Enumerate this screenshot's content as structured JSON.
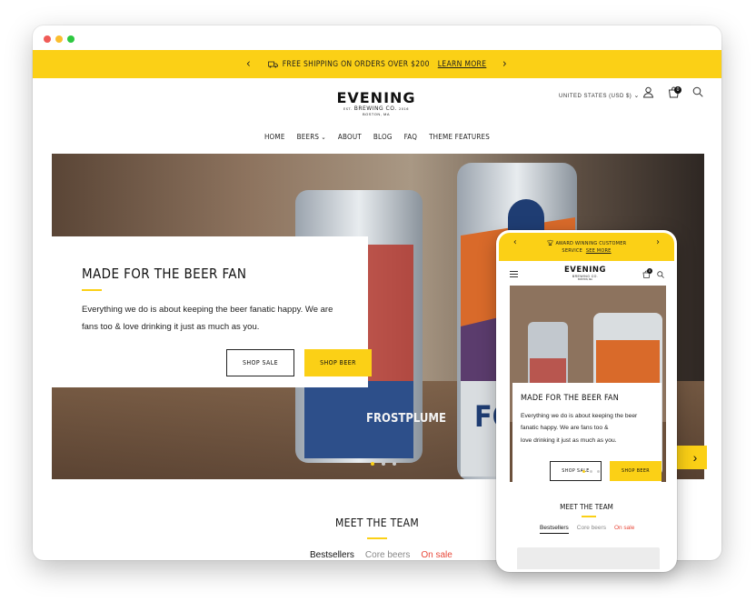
{
  "colors": {
    "accent": "#fbd016",
    "dot_red": "#f05b57",
    "dot_yellow": "#fbbe2e",
    "dot_green": "#2dc840",
    "sale": "#e8483a"
  },
  "promo": {
    "text": "FREE SHIPPING ON ORDERS OVER $200",
    "link": "LEARN MORE",
    "prev_icon": "chevron-left-icon",
    "next_icon": "chevron-right-icon",
    "truck_icon": "truck-icon"
  },
  "logo": {
    "main": "EVENING",
    "sub": "BREWING CO.",
    "small_left": "EST.",
    "small_right": "2016",
    "location": "BOSTON, MA"
  },
  "header": {
    "currency": "UNITED STATES (USD $)",
    "cart_count": "0"
  },
  "nav": [
    {
      "label": "HOME"
    },
    {
      "label": "BEERS"
    },
    {
      "label": "ABOUT"
    },
    {
      "label": "BLOG"
    },
    {
      "label": "FAQ"
    },
    {
      "label": "THEME FEATURES"
    }
  ],
  "hero": {
    "title": "MADE FOR THE BEER FAN",
    "body": "Everything we do is about keeping the beer fanatic happy. We are fans too & love drinking it just as much as you.",
    "btn_sale": "SHOP SALE",
    "btn_beer": "SHOP BEER",
    "can_left_text": "FROSTPLUME",
    "can_right_text": "FO",
    "active_slide": 1,
    "slide_count": 3
  },
  "team": {
    "title": "MEET THE TEAM",
    "tabs": [
      {
        "label": "Bestsellers"
      },
      {
        "label": "Core beers"
      },
      {
        "label": "On sale"
      }
    ]
  },
  "phone": {
    "promo_line1": "AWARD WINNING CUSTOMER",
    "promo_line2": "SERVICE",
    "promo_link": "SEE MORE",
    "logo_main": "EVENING",
    "logo_sub": "BREWING CO.",
    "logo_loc": "BOSTON, MA",
    "cart_count": "0",
    "hero_title": "MADE FOR THE BEER FAN",
    "hero_body_1": "Everything we do is about keeping the beer",
    "hero_body_2": "fanatic happy. We are fans too &",
    "hero_body_3": "love drinking it just as much as you.",
    "btn_sale": "SHOP SALE",
    "btn_beer": "SHOP BEER",
    "can_text": "BREWING CO.",
    "team_title": "MEET THE TEAM",
    "tabs": [
      {
        "label": "Bestsellers"
      },
      {
        "label": "Core beers"
      },
      {
        "label": "On sale"
      }
    ]
  }
}
